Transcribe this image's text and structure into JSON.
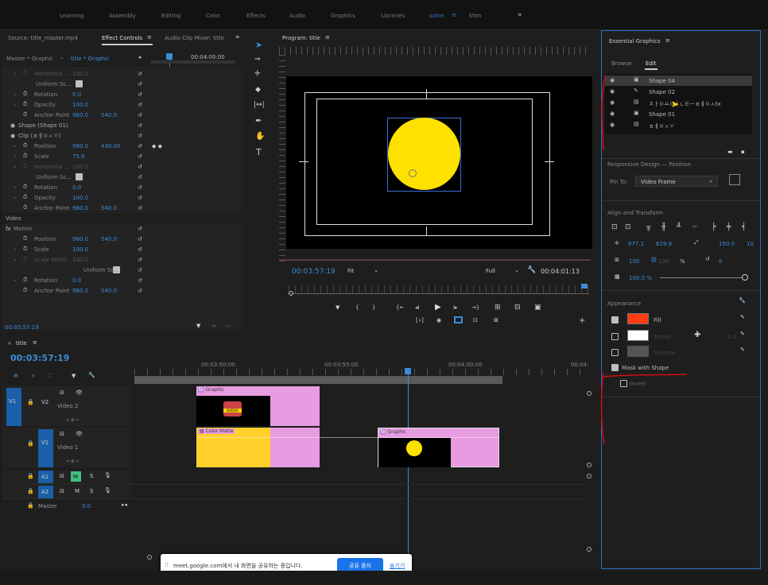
{
  "topbar": {
    "items": [
      "Learning",
      "Assembly",
      "Editing",
      "Color",
      "Effects",
      "Audio",
      "Graphics",
      "Libraries",
      "szlne",
      "khm"
    ],
    "more": "»"
  },
  "ec": {
    "tab_source": "Source: title_master.mp4",
    "tab_effect": "Effect Controls",
    "tab_mixer": "Audio Clip Mixer: title",
    "master": "Master * Graphic",
    "clip": "title * Graphic",
    "timecode": "00:04:00:00",
    "bottom_tc": "00:03:57:19",
    "rows": [
      {
        "l": "Horizontal ...",
        "v": "100.0",
        "dim": true,
        "caret": true
      },
      {
        "l": "Uniform Sc...",
        "check": true
      },
      {
        "l": "Rotation",
        "v": "0.0",
        "caret": true
      },
      {
        "l": "Opacity",
        "v": "100.0",
        "caret": true
      },
      {
        "l": "Anchor Point",
        "v": "960.0",
        "v2": "540.0"
      },
      {
        "l": "Shape (Shape 01)",
        "head": true
      },
      {
        "l": "Clip (ㅍㅔㅇㅅㅜ)",
        "head": true
      },
      {
        "l": "Position",
        "v": "960.0",
        "v2": "430.00",
        "caret": true,
        "kf": true
      },
      {
        "l": "Scale",
        "v": "75.0",
        "caret": true
      },
      {
        "l": "Horizontal ...",
        "v": "100.0",
        "dim": true,
        "caret": true
      },
      {
        "l": "Uniform Sc...",
        "check": true
      },
      {
        "l": "Rotation",
        "v": "0.0",
        "caret": true
      },
      {
        "l": "Opacity",
        "v": "100.0",
        "caret": true
      },
      {
        "l": "Anchor Point",
        "v": "960.0",
        "v2": "540.0"
      },
      {
        "l": "Video",
        "sect": true
      },
      {
        "l": "Motion",
        "fx": true
      },
      {
        "l": "Position",
        "v": "960.0",
        "v2": "540.0"
      },
      {
        "l": "Scale",
        "v": "100.0",
        "caret": true
      },
      {
        "l": "Scale Width",
        "v": "100.0",
        "dim": true,
        "caret": true
      },
      {
        "l": "Uniform Sc...",
        "check": true,
        "indent": true
      },
      {
        "l": "Rotation",
        "v": "0.0",
        "caret": true
      },
      {
        "l": "Anchor Point",
        "v": "960.0",
        "v2": "540.0"
      }
    ]
  },
  "program": {
    "title": "Program: title",
    "timecode": "00:03:57:19",
    "fit": "Fit",
    "full": "Full",
    "duration": "00:04:01:13"
  },
  "eg": {
    "title": "Essential Graphics",
    "browse": "Browse",
    "edit": "Edit",
    "layers": [
      "Shape 04",
      "Shape 02",
      "ㅈㅏㅇㅛㅇㅓㄴㅌㅡㅍㅔㅇㅅtx",
      "Shape 01",
      "ㅍㅔㅇㅅㅜ"
    ],
    "responsive": "Responsive Design — Position",
    "pin_to": "Pin To:",
    "pin_value": "Video Frame",
    "align": "Align and Transform",
    "pos_x": "877.1",
    "pos_y": "619.9",
    "rot": "150.0",
    "rot2": "10",
    "scale": "100",
    "scale2": "100",
    "pct": "%",
    "ang": "0",
    "opacity": "100.0 %",
    "appearance": "Appearance",
    "fill": "Fill",
    "stroke": "Stroke",
    "stroke_w": "1.0",
    "shadow": "Shadow",
    "mask": "Mask with Shape",
    "invert": "Invert",
    "colors": {
      "fill": "#ff3b12",
      "stroke": "#ffffff",
      "shadow": "#555555"
    }
  },
  "tl": {
    "title": "title",
    "timecode": "00:03:57:19",
    "ruler": [
      "00:03:50:00",
      "00:03:55:00",
      "00:04:00:00",
      "00:04:"
    ],
    "v2": "Video 2",
    "v1": "Video 1",
    "master": "Master",
    "master_val": "0.0",
    "clip_graphic": "Graphic",
    "clip_color": "Color Matte",
    "clip_graphic2": "Graphic",
    "mini_text": "BUDDA"
  },
  "banner": {
    "text": "meet.google.com에서 내 화면을 공유하는 중입니다.",
    "stop": "공유 중지",
    "hide": "숨기기"
  }
}
